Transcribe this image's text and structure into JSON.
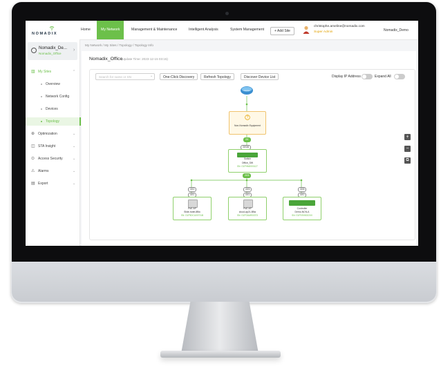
{
  "nav": {
    "brand": "NOMADIX",
    "items": [
      "Home",
      "My Network",
      "Management & Maintenance",
      "Intelligent Analysis",
      "System Management"
    ],
    "add_site": "+ Add Site",
    "user_email": "christophe.ameline@nomadix.com",
    "user_role": "Super Admin",
    "org": "Nomadix_Demo"
  },
  "sidebar": {
    "site_name": "Nomadix_De...",
    "site_sub": "Nomadix_Office",
    "my_sites": "My Sites",
    "sub_items": [
      "Overview",
      "Network Config",
      "Devices",
      "Topology"
    ],
    "menu": [
      "Optimization",
      "STA Insight",
      "Access Security",
      "Alarms",
      "Export"
    ]
  },
  "main": {
    "breadcrumb": "My Network  /  My Sites  /  Topology  /  Topology Info",
    "title": "Nomadix_Office",
    "update_time": "(Update Time: 2023-12-15 03:15)",
    "search_placeholder": "Search for name or SN",
    "btn_discovery": "One-Click Discovery",
    "btn_refresh": "Refresh Topology",
    "btn_discover_list": "Discover Device List",
    "display_ip": "Display IP Address",
    "expand_all": "Expand All"
  },
  "topology": {
    "internet_label": "Internet",
    "unknown_label": "Non-Nomadix Equipment",
    "switch": {
      "port": "GE0/8",
      "type": "Switch",
      "name": "Office_SW",
      "sn": "SN: G1PHM0000127",
      "uplink": "GE8"
    },
    "aps": [
      {
        "port": "GE2",
        "ap_port": "GE1",
        "type": "PoE AP",
        "name": "Slide-hotel-8Bw",
        "sn": "SN: G1P5DCU00731B"
      },
      {
        "port": "GE5",
        "ap_port": "GE1",
        "type": "PoE AP",
        "name": "cloud-ap21-8Bw",
        "sn": "SN: G1PG6AR00373"
      },
      {
        "port": "GE8",
        "ap_port": "GE0",
        "type": "Controller",
        "name": "Demo-NCN-A",
        "sn": "SN: G1P0SH0022X0"
      }
    ]
  }
}
